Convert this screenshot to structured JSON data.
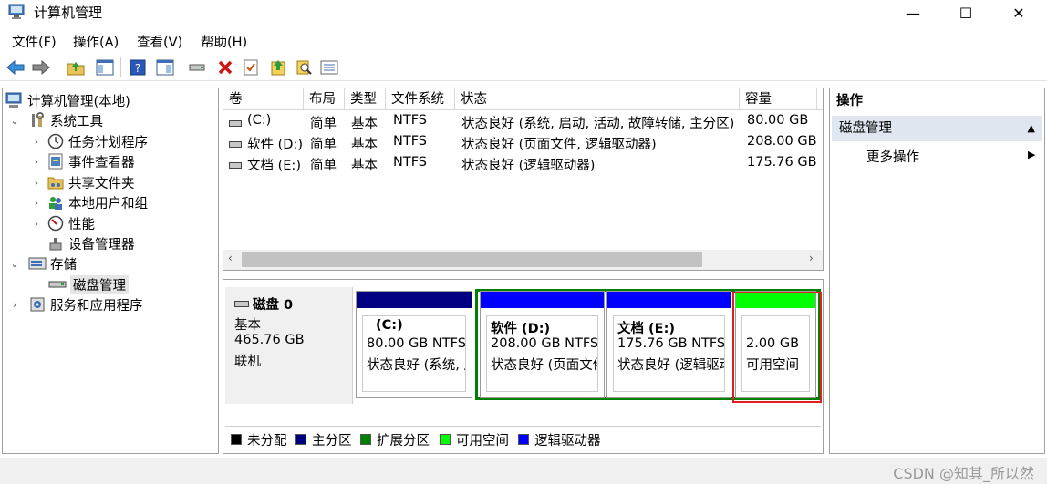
{
  "window": {
    "title": "计算机管理",
    "min": "—",
    "max": "☐",
    "close": "✕"
  },
  "menu": [
    "文件(F)",
    "操作(A)",
    "查看(V)",
    "帮助(H)"
  ],
  "tree": {
    "root": "计算机管理(本地)",
    "system_tools": "系统工具",
    "task_scheduler": "任务计划程序",
    "event_viewer": "事件查看器",
    "shared_folders": "共享文件夹",
    "local_users": "本地用户和组",
    "performance": "性能",
    "device_manager": "设备管理器",
    "storage": "存储",
    "disk_management": "磁盘管理",
    "services_apps": "服务和应用程序"
  },
  "volume_list": {
    "headers": [
      "卷",
      "布局",
      "类型",
      "文件系统",
      "状态",
      "容量"
    ],
    "rows": [
      {
        "volume": "(C:)",
        "layout": "简单",
        "type": "基本",
        "fs": "NTFS",
        "status": "状态良好 (系统, 启动, 活动, 故障转储, 主分区)",
        "capacity": "80.00 GB"
      },
      {
        "volume": "软件 (D:)",
        "layout": "简单",
        "type": "基本",
        "fs": "NTFS",
        "status": "状态良好 (页面文件, 逻辑驱动器)",
        "capacity": "208.00 GB"
      },
      {
        "volume": "文档 (E:)",
        "layout": "简单",
        "type": "基本",
        "fs": "NTFS",
        "status": "状态良好 (逻辑驱动器)",
        "capacity": "175.76 GB"
      }
    ],
    "scroll_left": "‹",
    "scroll_right": "›"
  },
  "disk": {
    "name": "磁盘 0",
    "type": "基本",
    "size": "465.76 GB",
    "state": "联机",
    "partitions": [
      {
        "title": "(C:)",
        "size": "80.00 GB NTFS",
        "status": "状态良好 (系统, 启"
      },
      {
        "title": "软件 (D:)",
        "size": "208.00 GB NTFS",
        "status": "状态良好 (页面文件"
      },
      {
        "title": "文档 (E:)",
        "size": "175.76 GB NTFS",
        "status": "状态良好 (逻辑驱动"
      },
      {
        "title": "",
        "size": "2.00 GB",
        "status": "可用空间"
      }
    ]
  },
  "legend": [
    {
      "label": "未分配",
      "color": "#000000"
    },
    {
      "label": "主分区",
      "color": "#00007f"
    },
    {
      "label": "扩展分区",
      "color": "#007f00"
    },
    {
      "label": "可用空间",
      "color": "#00ff00"
    },
    {
      "label": "逻辑驱动器",
      "color": "#0000ff"
    }
  ],
  "colors": {
    "primary": "#000080",
    "logical": "#0000ff",
    "free": "#00ff00",
    "extended_border": "#008000",
    "highlight_border": "#e02020"
  },
  "actions": {
    "header": "操作",
    "section": "磁盘管理",
    "more": "更多操作"
  },
  "watermark": "CSDN @知其_所以然"
}
